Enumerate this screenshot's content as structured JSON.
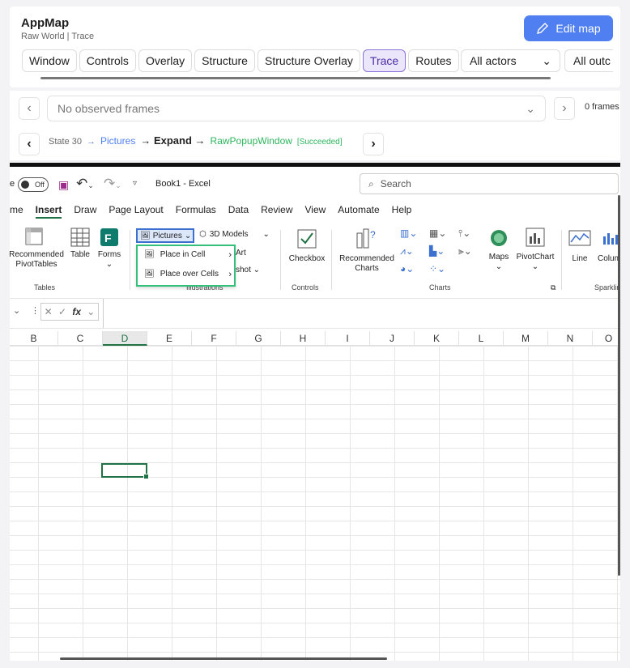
{
  "header": {
    "title": "AppMap",
    "subtitle": "Raw World | Trace",
    "edit_label": "Edit map",
    "tabs": [
      "Window",
      "Controls",
      "Overlay",
      "Structure",
      "Structure Overlay",
      "Trace",
      "Routes"
    ],
    "active_tab": "Trace",
    "actors_select": "All actors",
    "outcome_select": "All outc"
  },
  "frames": {
    "placeholder": "No observed frames",
    "count": "0 frames"
  },
  "trace": {
    "state": "State 30",
    "arrow": "→",
    "from": "Pictures",
    "action": "→ Expand →",
    "window": "RawPopupWindow",
    "status": "[Succeeded]"
  },
  "excel": {
    "autosave": "Off",
    "autosave_prefix": "e",
    "doc_title": "Book1 - Excel",
    "search_placeholder": "Search",
    "menu": [
      "me",
      "Insert",
      "Draw",
      "Page Layout",
      "Formulas",
      "Data",
      "Review",
      "View",
      "Automate",
      "Help"
    ],
    "active_menu": "Insert",
    "ribbon": {
      "recommended_pivot": "Recommended PivotTables",
      "table": "Table",
      "forms": "Forms",
      "tables_group": "Tables",
      "pictures": "Pictures",
      "models_3d": "3D Models",
      "art": "Art",
      "shot": "shot",
      "illustrations_group": "Illustrations",
      "place_in_cell": "Place in Cell",
      "place_over_cells": "Place over Cells",
      "checkbox": "Checkbox",
      "controls_group": "Controls",
      "recommended_charts": "Recommended Charts",
      "maps": "Maps",
      "pivotchart": "PivotChart",
      "charts_group": "Charts",
      "line": "Line",
      "column": "Column",
      "sparklines_group": "Sparkline"
    },
    "fx": "fx",
    "columns": [
      "B",
      "C",
      "D",
      "E",
      "F",
      "G",
      "H",
      "I",
      "J",
      "K",
      "L",
      "M",
      "N",
      "O"
    ],
    "selected_column": "D"
  }
}
